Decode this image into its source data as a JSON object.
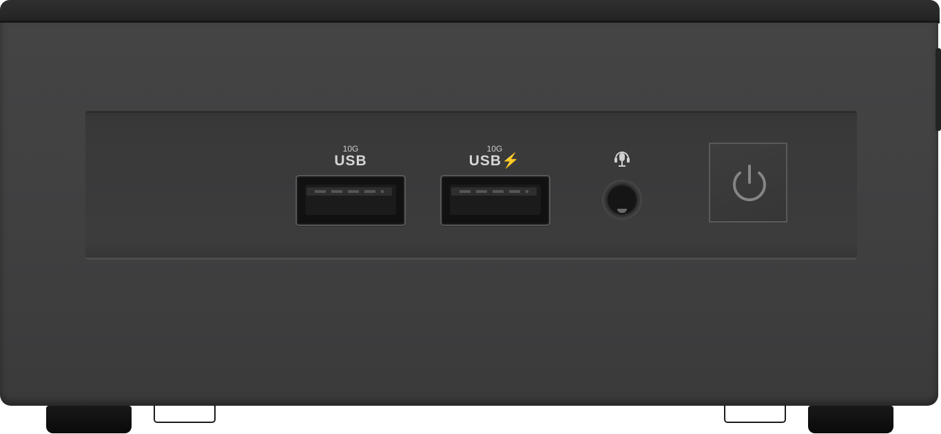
{
  "ports": [
    {
      "speed": "10G",
      "name": "USB"
    },
    {
      "speed": "10G",
      "name": "USB⚡"
    }
  ],
  "icons": {
    "audio": "headset-mic-icon",
    "power": "power-icon"
  },
  "colors": {
    "chassis": "#414142",
    "label": "#d6d6d6"
  }
}
